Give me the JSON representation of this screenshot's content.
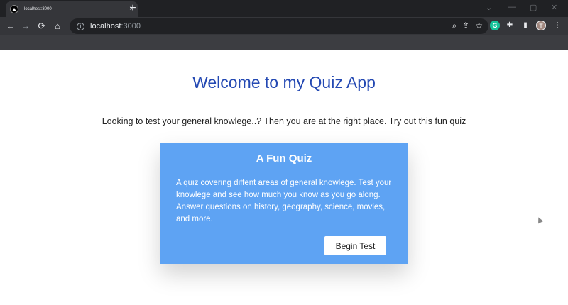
{
  "browser": {
    "tab_title": "localhost:3000",
    "tab_close": "×",
    "new_tab": "+",
    "url_host": "localhost",
    "url_port": ":3000",
    "profile_initial": "T",
    "grammarly_letter": "G",
    "icons": {
      "back": "arrow-left-icon",
      "forward": "arrow-right-icon",
      "reload": "reload-icon",
      "home": "home-icon",
      "info": "info-icon",
      "zoom": "magnifier-icon",
      "share": "share-icon",
      "bookmark": "star-icon",
      "extensions": "puzzle-icon",
      "sidepanel": "side-panel-icon",
      "menu": "kebab-menu-icon"
    }
  },
  "page": {
    "title": "Welcome to my Quiz App",
    "intro": "Looking to test your general knowlege..? Then you are at the right place. Try out this fun quiz",
    "card": {
      "title": "A Fun Quiz",
      "description": "A quiz covering diffent areas of general knowlege. Test your knowlege and see how much you know as you go along. Answer questions on history, geography, science, movies, and more.",
      "button_label": "Begin Test"
    },
    "colors": {
      "title": "#2449b3",
      "card_bg": "#5ea3f3",
      "chrome_dark": "#202124",
      "chrome_toolbar": "#35363a"
    }
  }
}
